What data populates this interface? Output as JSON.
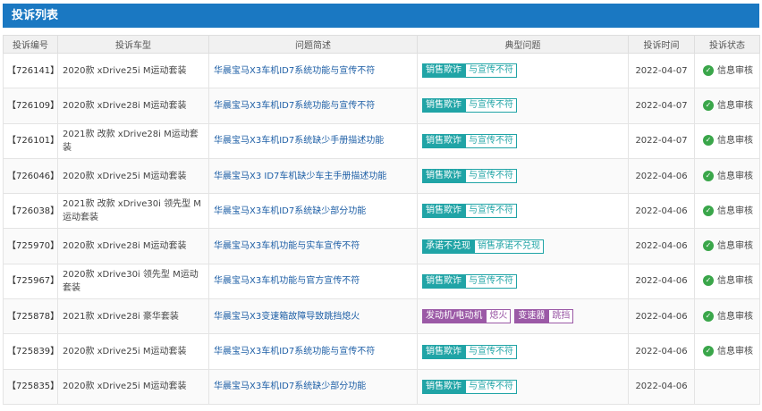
{
  "panel": {
    "title": "投诉列表"
  },
  "table": {
    "headers": [
      "投诉编号",
      "投诉车型",
      "问题简述",
      "典型问题",
      "投诉时间",
      "投诉状态"
    ],
    "rows": [
      {
        "id": "【726141】",
        "model": "2020款 xDrive25i M运动套装",
        "summary": "华晨宝马X3车机ID7系统功能与宣传不符",
        "tags": [
          {
            "main": "销售欺诈",
            "sub": "与宣传不符",
            "color": "#20a4a6"
          }
        ],
        "time": "2022-04-07",
        "status": "信息审核"
      },
      {
        "id": "【726109】",
        "model": "2020款 xDrive28i M运动套装",
        "summary": "华晨宝马X3车机ID7系统功能与宣传不符",
        "tags": [
          {
            "main": "销售欺诈",
            "sub": "与宣传不符",
            "color": "#20a4a6"
          }
        ],
        "time": "2022-04-07",
        "status": "信息审核"
      },
      {
        "id": "【726101】",
        "model": "2021款 改款 xDrive28i M运动套装",
        "summary": "华晨宝马X3车机ID7系统缺少手册描述功能",
        "tags": [
          {
            "main": "销售欺诈",
            "sub": "与宣传不符",
            "color": "#20a4a6"
          }
        ],
        "time": "2022-04-07",
        "status": "信息审核"
      },
      {
        "id": "【726046】",
        "model": "2020款 xDrive25i M运动套装",
        "summary": "华晨宝马X3 ID7车机缺少车主手册描述功能",
        "tags": [
          {
            "main": "销售欺诈",
            "sub": "与宣传不符",
            "color": "#20a4a6"
          }
        ],
        "time": "2022-04-06",
        "status": "信息审核"
      },
      {
        "id": "【726038】",
        "model": "2021款 改款 xDrive30i 领先型 M运动套装",
        "summary": "华晨宝马X3车机ID7系统缺少部分功能",
        "tags": [
          {
            "main": "销售欺诈",
            "sub": "与宣传不符",
            "color": "#20a4a6"
          }
        ],
        "time": "2022-04-06",
        "status": "信息审核"
      },
      {
        "id": "【725970】",
        "model": "2020款 xDrive28i M运动套装",
        "summary": "华晨宝马X3车机功能与实车宣传不符",
        "tags": [
          {
            "main": "承诺不兑现",
            "sub": "销售承诺不兑现",
            "color": "#20a4a6"
          }
        ],
        "time": "2022-04-06",
        "status": "信息审核"
      },
      {
        "id": "【725967】",
        "model": "2020款 xDrive30i 领先型 M运动套装",
        "summary": "华晨宝马X3车机功能与官方宣传不符",
        "tags": [
          {
            "main": "销售欺诈",
            "sub": "与宣传不符",
            "color": "#20a4a6"
          }
        ],
        "time": "2022-04-06",
        "status": "信息审核"
      },
      {
        "id": "【725878】",
        "model": "2021款 xDrive28i 豪华套装",
        "summary": "华晨宝马X3变速箱故障导致跳挡熄火",
        "tags": [
          {
            "main": "发动机/电动机",
            "sub": "熄火",
            "color": "#9b59a6"
          },
          {
            "main": "变速器",
            "sub": "跳挡",
            "color": "#9b59a6"
          }
        ],
        "time": "2022-04-06",
        "status": "信息审核"
      },
      {
        "id": "【725839】",
        "model": "2020款 xDrive25i M运动套装",
        "summary": "华晨宝马X3车机ID7系统功能与宣传不符",
        "tags": [
          {
            "main": "销售欺诈",
            "sub": "与宣传不符",
            "color": "#20a4a6"
          }
        ],
        "time": "2022-04-06",
        "status": "信息审核"
      },
      {
        "id": "【725835】",
        "model": "2020款 xDrive25i M运动套装",
        "summary": "华晨宝马X3车机ID7系统缺少部分功能",
        "tags": [
          {
            "main": "销售欺诈",
            "sub": "与宣传不符",
            "color": "#20a4a6"
          }
        ],
        "time": "2022-04-06",
        "status": ""
      }
    ]
  },
  "icons": {
    "status": "check-circle-icon"
  }
}
